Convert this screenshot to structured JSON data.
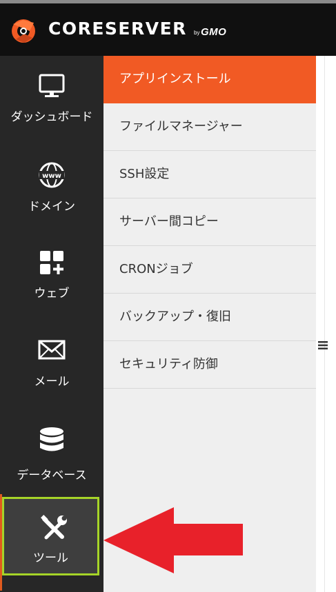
{
  "header": {
    "logo_text": "CORESERVER",
    "logo_by": "by",
    "logo_gmo": "GMO",
    "logo_icon": "coreserver-logo-mark"
  },
  "sidebar": {
    "items": [
      {
        "label": "ダッシュボード",
        "icon": "monitor-icon"
      },
      {
        "label": "ドメイン",
        "icon": "www-globe-icon"
      },
      {
        "label": "ウェブ",
        "icon": "grid-plus-icon"
      },
      {
        "label": "メール",
        "icon": "envelope-icon"
      },
      {
        "label": "データベース",
        "icon": "database-icon"
      },
      {
        "label": "ツール",
        "icon": "tools-icon"
      }
    ],
    "active_index": 5,
    "active_border_color": "#a6d428"
  },
  "submenu": {
    "items": [
      {
        "label": "アプリインストール"
      },
      {
        "label": "ファイルマネージャー"
      },
      {
        "label": "SSH設定"
      },
      {
        "label": "サーバー間コピー"
      },
      {
        "label": "CRONジョブ"
      },
      {
        "label": "バックアップ・復旧"
      },
      {
        "label": "セキュリティ防御"
      }
    ],
    "active_index": 0,
    "accent_color": "#f15a24"
  },
  "right_pane": {
    "menu_icon": "hamburger-icon"
  },
  "annotation": {
    "arrow_color": "#e8212a",
    "points_to": "ツール"
  }
}
